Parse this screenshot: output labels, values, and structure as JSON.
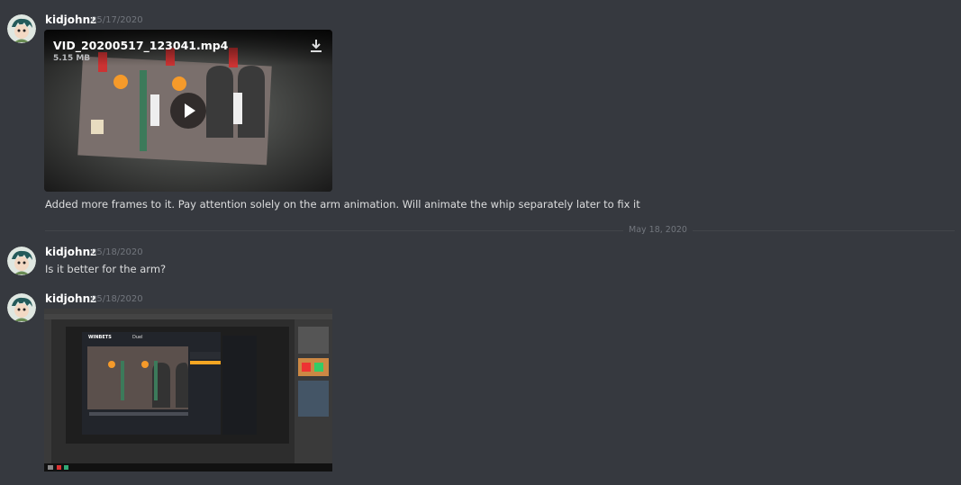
{
  "messages": [
    {
      "author": "kidjohnz",
      "timestamp": "05/17/2020",
      "attachment": {
        "file_name": "VID_20200517_123041.mp4",
        "file_size": "5.15 MB"
      },
      "text": "Added more frames to it. Pay attention solely on the arm animation. Will animate the whip separately later to fix it"
    },
    {
      "author": "kidjohnz",
      "timestamp": "05/18/2020",
      "text": "Is it better for the arm?"
    },
    {
      "author": "kidjohnz",
      "timestamp": "05/18/2020",
      "image_labels": {
        "brand": "WINBETS",
        "mode": "Duel"
      }
    }
  ],
  "date_divider": "May 18, 2020",
  "icons": [
    "avatar",
    "download-icon",
    "play-icon"
  ],
  "colors": {
    "background": "#36393f",
    "author": "#ffffff",
    "timestamp": "#72767d",
    "text": "#dcddde"
  }
}
